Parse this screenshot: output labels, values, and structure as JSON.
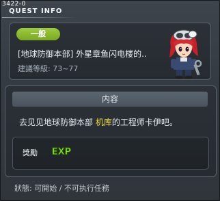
{
  "window": {
    "id_text": "3422-0",
    "title": "QUEST INFO"
  },
  "quest": {
    "category": "一般",
    "name": "[地球防御本部] 外星章鱼闪电楼的..",
    "level_label": "建議等級:",
    "level_range": "73~77"
  },
  "content": {
    "header": "内容",
    "desc_before": "去见见地球防御本部 ",
    "desc_highlight": "机库",
    "desc_after": "的工程师卡伊吧。"
  },
  "reward": {
    "label": "獎勵",
    "exp_text": "EXP"
  },
  "status": {
    "label": "狀態:",
    "value": "可開始 / 不可执行任務"
  },
  "colors": {
    "tag_green": "#8cbc30",
    "highlight_yellow": "#f3e046",
    "exp_green": "#8cf21c"
  },
  "icons": {
    "npc": "npc-portrait-icon",
    "exp": "exp-icon"
  }
}
